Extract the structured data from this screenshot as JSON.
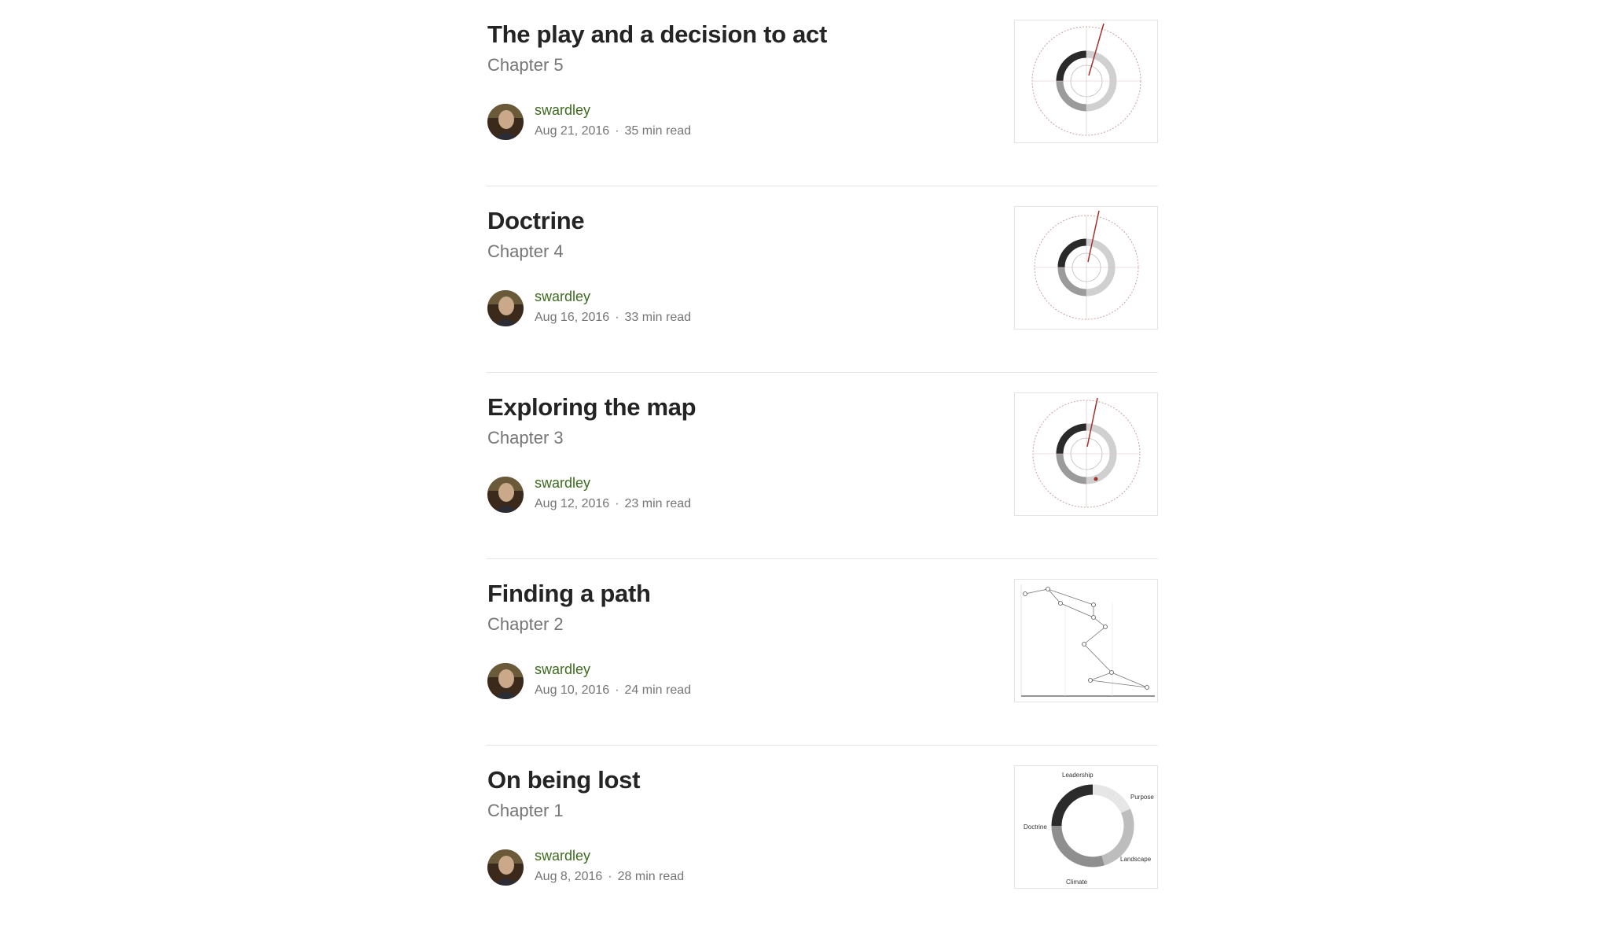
{
  "posts": [
    {
      "title": "The play and a decision to act",
      "subtitle": "Chapter 5",
      "author": "swardley",
      "date": "Aug 21, 2016",
      "read_time": "35 min read",
      "thumbnail_icon": "strategy-cycle-diagram"
    },
    {
      "title": "Doctrine",
      "subtitle": "Chapter 4",
      "author": "swardley",
      "date": "Aug 16, 2016",
      "read_time": "33 min read",
      "thumbnail_icon": "strategy-cycle-diagram"
    },
    {
      "title": "Exploring the map",
      "subtitle": "Chapter 3",
      "author": "swardley",
      "date": "Aug 12, 2016",
      "read_time": "23 min read",
      "thumbnail_icon": "strategy-cycle-diagram"
    },
    {
      "title": "Finding a path",
      "subtitle": "Chapter 2",
      "author": "swardley",
      "date": "Aug 10, 2016",
      "read_time": "24 min read",
      "thumbnail_icon": "wardley-map-diagram"
    },
    {
      "title": "On being lost",
      "subtitle": "Chapter 1",
      "author": "swardley",
      "date": "Aug 8, 2016",
      "read_time": "28 min read",
      "thumbnail_icon": "strategy-cycle-diagram",
      "thumbnail_labels": [
        "Leadership",
        "Purpose",
        "Doctrine",
        "Landscape",
        "Climate"
      ]
    }
  ],
  "meta_separator": "·",
  "colors": {
    "author_link": "#3d6b1e",
    "title": "#242424",
    "muted": "#757575",
    "divider": "#e6e6e6",
    "accent_red": "#a3302a"
  }
}
